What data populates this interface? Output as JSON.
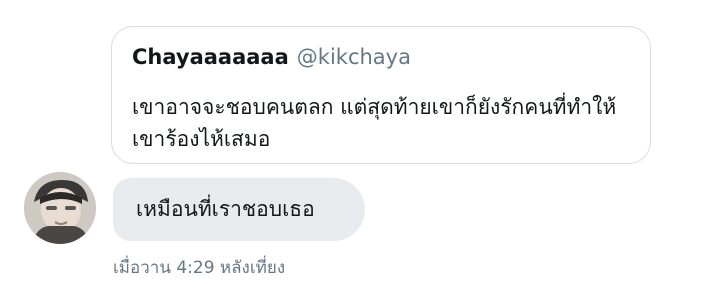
{
  "quoted_tweet": {
    "display_name": "Chayaaaaaaa",
    "handle": "@kikchaya",
    "text": "เขาอาจจะชอบคนตลก แต่สุดท้ายเขาก็ยังรักคนที่ทำให้เขาร้องไห้เสมอ"
  },
  "message": {
    "text": "เหมือนที่เราชอบเธอ",
    "timestamp": "เมื่อวาน 4:29 หลังเที่ยง"
  },
  "colors": {
    "bubble_background": "#e7ebee",
    "card_border": "#d7dde2",
    "secondary_text": "#657786",
    "primary_text": "#14171a"
  }
}
